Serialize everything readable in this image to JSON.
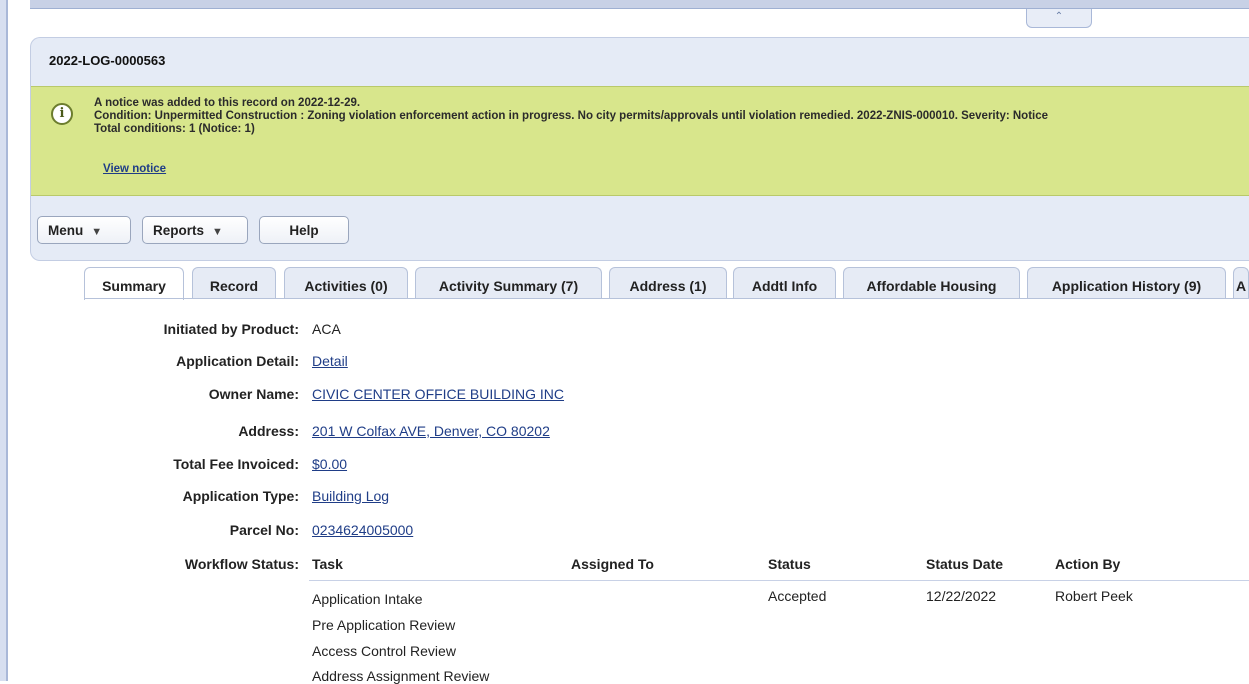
{
  "collapse_icon": "double-chevron-up-icon",
  "record_id": "2022-LOG-0000563",
  "notice": {
    "icon": "info-icon",
    "line1": "A notice was added to this record on 2022-12-29.",
    "line2": "Condition: Unpermitted Construction : Zoning violation enforcement action in progress. No city permits/approvals until violation remedied. 2022-ZNIS-000010. Severity: Notice",
    "line3": "Total conditions: 1   (Notice: 1)",
    "view_link": "View notice"
  },
  "toolbar": {
    "menu_label": "Menu",
    "reports_label": "Reports",
    "help_label": "Help"
  },
  "tabs": [
    {
      "label": "Summary"
    },
    {
      "label": "Record"
    },
    {
      "label": "Activities (0)"
    },
    {
      "label": "Activity Summary (7)"
    },
    {
      "label": "Address (1)"
    },
    {
      "label": "Addtl Info"
    },
    {
      "label": "Affordable Housing"
    },
    {
      "label": "Application History (9)"
    },
    {
      "label": "A"
    }
  ],
  "summary": {
    "initiated_label": "Initiated by Product:",
    "initiated_value": "ACA",
    "app_detail_label": "Application Detail:",
    "app_detail_value": "Detail",
    "owner_label": "Owner Name:",
    "owner_value": "CIVIC CENTER OFFICE BUILDING INC",
    "address_label": "Address:",
    "address_value": "201 W Colfax AVE, Denver, CO 80202",
    "fee_label": "Total Fee Invoiced:",
    "fee_value": "$0.00",
    "app_type_label": "Application Type:",
    "app_type_value": "Building Log",
    "parcel_label": "Parcel No:",
    "parcel_value": "0234624005000",
    "workflow_label": "Workflow Status:"
  },
  "workflow": {
    "headers": {
      "task": "Task",
      "assigned": "Assigned To",
      "status": "Status",
      "status_date": "Status Date",
      "action_by": "Action By"
    },
    "rows": [
      {
        "task": "Application Intake",
        "status": "Accepted",
        "date": "12/22/2022",
        "action_by": "Robert Peek"
      },
      {
        "task": "Pre Application Review"
      },
      {
        "task": "Access Control Review"
      },
      {
        "task": "Address Assignment Review"
      }
    ]
  }
}
